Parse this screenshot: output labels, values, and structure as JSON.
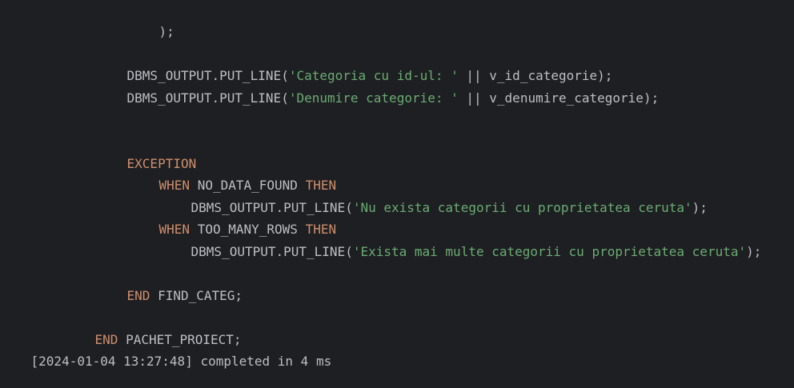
{
  "code": {
    "close_paren": ");",
    "line_put1": {
      "fn": "DBMS_OUTPUT.PUT_LINE(",
      "str": "'Categoria cu id-ul: '",
      "rest": " || v_id_categorie);"
    },
    "line_put2": {
      "fn": "DBMS_OUTPUT.PUT_LINE(",
      "str": "'Denumire categorie: '",
      "rest": " || v_denumire_categorie);"
    },
    "exception_kw": "EXCEPTION",
    "when1": {
      "kw": "WHEN",
      "name": " NO_DATA_FOUND ",
      "then": "THEN"
    },
    "put3": {
      "fn": "DBMS_OUTPUT.PUT_LINE(",
      "str": "'Nu exista categorii cu proprietatea ceruta'",
      "rest": ");"
    },
    "when2": {
      "kw": "WHEN",
      "name": " TOO_MANY_ROWS ",
      "then": "THEN"
    },
    "put4": {
      "fn": "DBMS_OUTPUT.PUT_LINE(",
      "str": "'Exista mai multe categorii cu proprietatea ceruta'",
      "rest": ");"
    },
    "end_find": {
      "kw": "END",
      "name": " FIND_CATEG;"
    },
    "end_pachet": {
      "kw": "END",
      "name": " PACHET_PROIECT;"
    }
  },
  "console": {
    "status": "[2024-01-04 13:27:48] completed in 4 ms"
  },
  "colors": {
    "background": "#1e1f22",
    "keyword": "#cf8e6d",
    "string": "#6aab73",
    "text": "#bcbec4"
  }
}
